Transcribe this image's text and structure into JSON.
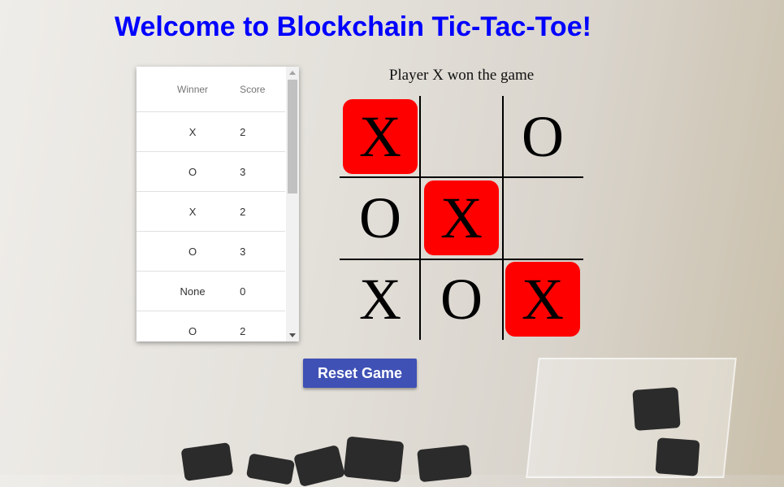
{
  "page": {
    "title": "Welcome to Blockchain Tic-Tac-Toe!"
  },
  "score_table": {
    "headers": {
      "winner": "Winner",
      "score": "Score"
    },
    "rows": [
      {
        "winner": "X",
        "score": "2"
      },
      {
        "winner": "O",
        "score": "3"
      },
      {
        "winner": "X",
        "score": "2"
      },
      {
        "winner": "O",
        "score": "3"
      },
      {
        "winner": "None",
        "score": "0"
      },
      {
        "winner": "O",
        "score": "2"
      }
    ]
  },
  "game": {
    "status": "Player X won the game",
    "board": [
      "X",
      "",
      "O",
      "O",
      "X",
      "",
      "X",
      "O",
      "X"
    ],
    "winning_cells": [
      0,
      4,
      8
    ],
    "win_color": "#ff0000"
  },
  "controls": {
    "reset_label": "Reset Game",
    "reset_color": "#3f51b5"
  },
  "colors": {
    "title": "#0000ff"
  }
}
